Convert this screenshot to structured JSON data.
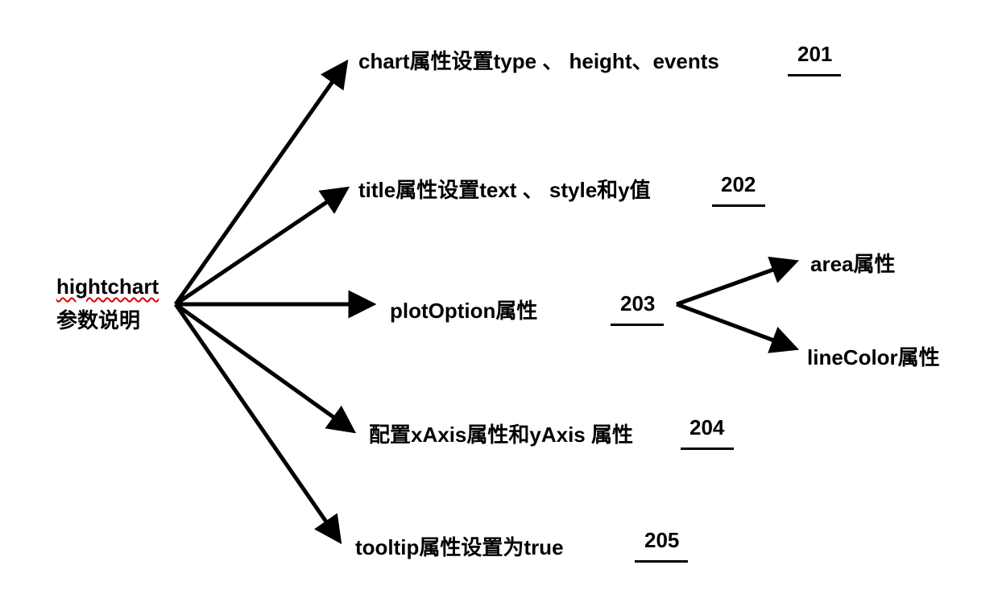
{
  "root": {
    "title_line1": "hightchart",
    "title_line2": "参数说明"
  },
  "branches": [
    {
      "text": "chart属性设置type 、 height、events",
      "ref": "201"
    },
    {
      "text": "title属性设置text 、 style和y值",
      "ref": "202"
    },
    {
      "text": "plotOption属性",
      "ref": "203",
      "children": [
        "area属性",
        "lineColor属性"
      ]
    },
    {
      "text": "配置xAxis属性和yAxis 属性",
      "ref": "204"
    },
    {
      "text": "tooltip属性设置为true",
      "ref": "205"
    }
  ]
}
